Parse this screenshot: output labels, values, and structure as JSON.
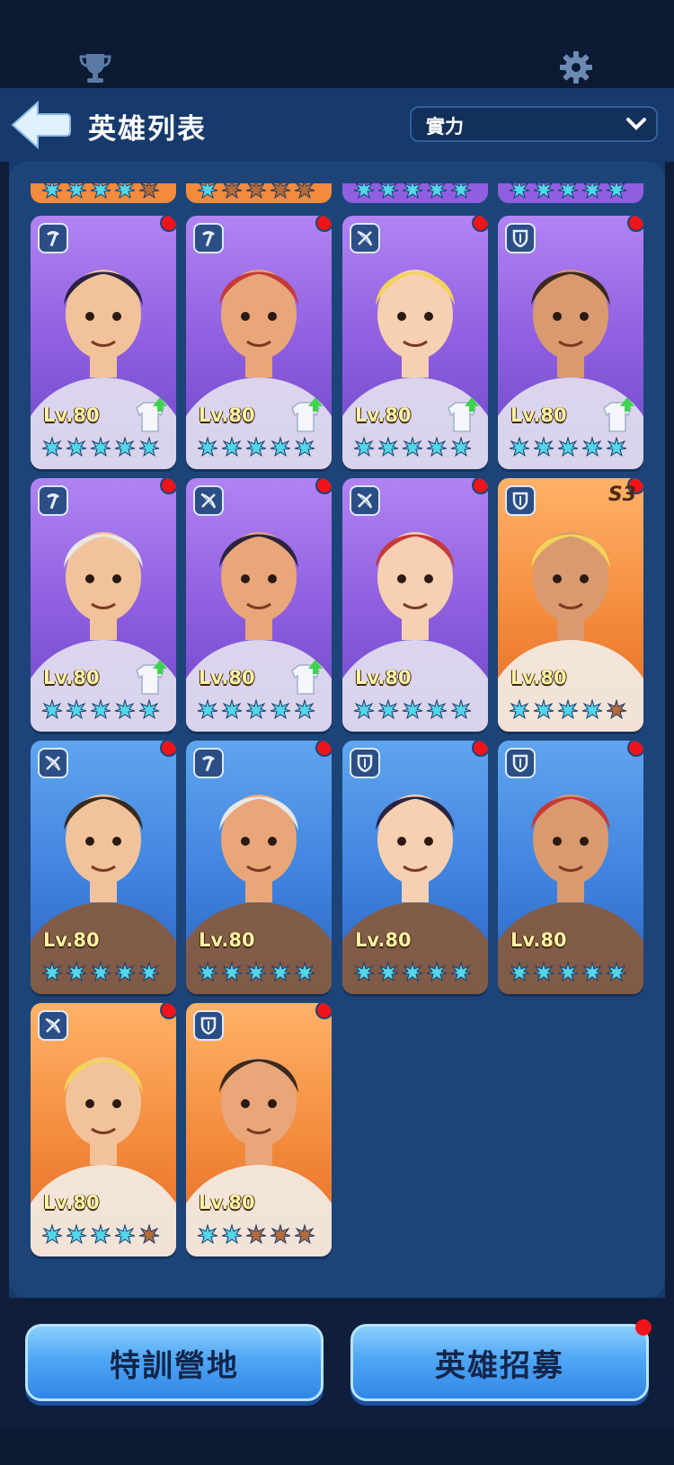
{
  "header": {
    "title": "英雄列表",
    "sort_label": "實力",
    "icons": [
      "trophy-icon",
      "gear-icon",
      "back-arrow-icon",
      "chevron-down-icon"
    ]
  },
  "colors": {
    "panel": "#1c4478",
    "purple_card": "#8f5fe0",
    "blue_card": "#3f82df",
    "orange_card": "#f38a3c",
    "star_active": "#54d6e9",
    "star_inactive": "#b36b3a",
    "level_text": "#fff4a3",
    "notification": "#f0141a"
  },
  "partial_row": [
    {
      "rarity": "orange",
      "stars_filled": 4
    },
    {
      "rarity": "orange",
      "stars_filled": 1
    },
    {
      "rarity": "purple",
      "stars_filled": 5
    },
    {
      "rarity": "purple",
      "stars_filled": 5
    }
  ],
  "heroes": [
    {
      "level": "Lv.80",
      "rarity": "purple",
      "role": "pickaxe-icon",
      "stars_filled": 5,
      "outfit_upgrade": true,
      "badge": "",
      "new": true
    },
    {
      "level": "Lv.80",
      "rarity": "purple",
      "role": "pickaxe-icon",
      "stars_filled": 5,
      "outfit_upgrade": true,
      "badge": "",
      "new": true
    },
    {
      "level": "Lv.80",
      "rarity": "purple",
      "role": "crossbow-icon",
      "stars_filled": 5,
      "outfit_upgrade": true,
      "badge": "",
      "new": true
    },
    {
      "level": "Lv.80",
      "rarity": "purple",
      "role": "shield-icon",
      "stars_filled": 5,
      "outfit_upgrade": true,
      "badge": "",
      "new": true
    },
    {
      "level": "Lv.80",
      "rarity": "purple",
      "role": "pickaxe-icon",
      "stars_filled": 5,
      "outfit_upgrade": true,
      "badge": "",
      "new": true
    },
    {
      "level": "Lv.80",
      "rarity": "purple",
      "role": "crossbow-icon",
      "stars_filled": 5,
      "outfit_upgrade": true,
      "badge": "",
      "new": true
    },
    {
      "level": "Lv.80",
      "rarity": "purple",
      "role": "crossbow-icon",
      "stars_filled": 5,
      "outfit_upgrade": false,
      "badge": "",
      "new": true
    },
    {
      "level": "Lv.80",
      "rarity": "orange",
      "role": "shield-icon",
      "stars_filled": 4,
      "outfit_upgrade": false,
      "badge": "S3",
      "new": true
    },
    {
      "level": "Lv.80",
      "rarity": "blue",
      "role": "crossbow-icon",
      "stars_filled": 5,
      "outfit_upgrade": false,
      "badge": "",
      "new": true
    },
    {
      "level": "Lv.80",
      "rarity": "blue",
      "role": "pickaxe-icon",
      "stars_filled": 5,
      "outfit_upgrade": false,
      "badge": "",
      "new": true
    },
    {
      "level": "Lv.80",
      "rarity": "blue",
      "role": "shield-icon",
      "stars_filled": 5,
      "outfit_upgrade": false,
      "badge": "",
      "new": true
    },
    {
      "level": "Lv.80",
      "rarity": "blue",
      "role": "shield-icon",
      "stars_filled": 5,
      "outfit_upgrade": false,
      "badge": "",
      "new": true
    },
    {
      "level": "Lv.80",
      "rarity": "orange",
      "role": "crossbow-icon",
      "stars_filled": 4,
      "outfit_upgrade": false,
      "badge": "",
      "new": true
    },
    {
      "level": "Lv.80",
      "rarity": "orange",
      "role": "shield-icon",
      "stars_filled": 2,
      "outfit_upgrade": false,
      "badge": "",
      "new": true
    }
  ],
  "buttons": {
    "training_camp": "特訓營地",
    "hero_recruit": "英雄招募"
  }
}
